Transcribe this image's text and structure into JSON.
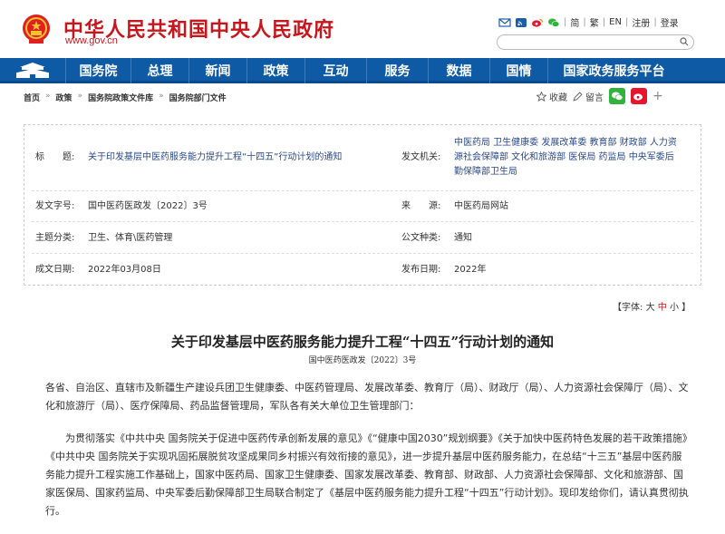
{
  "header": {
    "site_title": "中华人民共和国中央人民政府",
    "site_url": "www.gov.cn",
    "lang_simplified": "简",
    "lang_traditional": "繁",
    "lang_en": "EN",
    "register": "注册",
    "login": "登录"
  },
  "nav": {
    "items": [
      "国务院",
      "总理",
      "新闻",
      "政策",
      "互动",
      "服务",
      "数据",
      "国情",
      "国家政务服务平台"
    ]
  },
  "breadcrumb": {
    "items": [
      "首页",
      "政策",
      "国务院政策文件库",
      "国务院部门文件"
    ],
    "sep": "»"
  },
  "tools": {
    "favorite": "收藏",
    "comment": "留言"
  },
  "info": {
    "title_label": "标　　题:",
    "title_value": "关于印发基层中医药服务能力提升工程“十四五”行动计划的通知",
    "issuer_label": "发文机关:",
    "issuer_value_1": "中医药局 卫生健康委 发展改革委 教育部 财政部 人力资",
    "issuer_value_2": "源社会保障部 文化和旅游部 医保局 药监局 中央军委后",
    "issuer_value_3": "勤保障部卫生局",
    "docno_label": "发文字号:",
    "docno_value": "国中医药医政发〔2022〕3号",
    "source_label": "来　　源:",
    "source_value": "中医药局网站",
    "topic_label": "主题分类:",
    "topic_value": "卫生、体育\\医药管理",
    "type_label": "公文种类:",
    "type_value": "通知",
    "created_label": "成文日期:",
    "created_value": "2022年03月08日",
    "published_label": "发布日期:",
    "published_value": "2022年"
  },
  "fontsize": {
    "prefix": "【字体:",
    "large": "大",
    "medium": "中",
    "small": "小",
    "suffix": "】"
  },
  "article": {
    "title": "关于印发基层中医药服务能力提升工程“十四五”行动计划的通知",
    "doc_no": "国中医药医政发〔2022〕3号",
    "para1": "各省、自治区、直辖市及新疆生产建设兵团卫生健康委、中医药管理局、发展改革委、教育厅（局）、财政厅（局）、人力资源社会保障厅（局）、文化和旅游厅（局）、医疗保障局、药品监督管理局，军队各有关大单位卫生管理部门：",
    "para2": "为贯彻落实《中共中央 国务院关于促进中医药传承创新发展的意见》《“健康中国2030”规划纲要》《关于加快中医药特色发展的若干政策措施》《中共中央 国务院关于实现巩固拓展脱贫攻坚成果同乡村振兴有效衔接的意见》，进一步提升基层中医药服务能力，在总结“十三五”基层中医药服务能力提升工程实施工作基础上，国家中医药局、国家卫生健康委、国家发展改革委、教育部、财政部、人力资源社会保障部、文化和旅游部、国家医保局、国家药监局、中央军委后勤保障部卫生局联合制定了《基层中医药服务能力提升工程“十四五”行动计划》。现印发给你们，请认真贯彻执行。"
  },
  "colors": {
    "brand_red": "#c8161d",
    "nav_blue": "#0e5aa4"
  }
}
